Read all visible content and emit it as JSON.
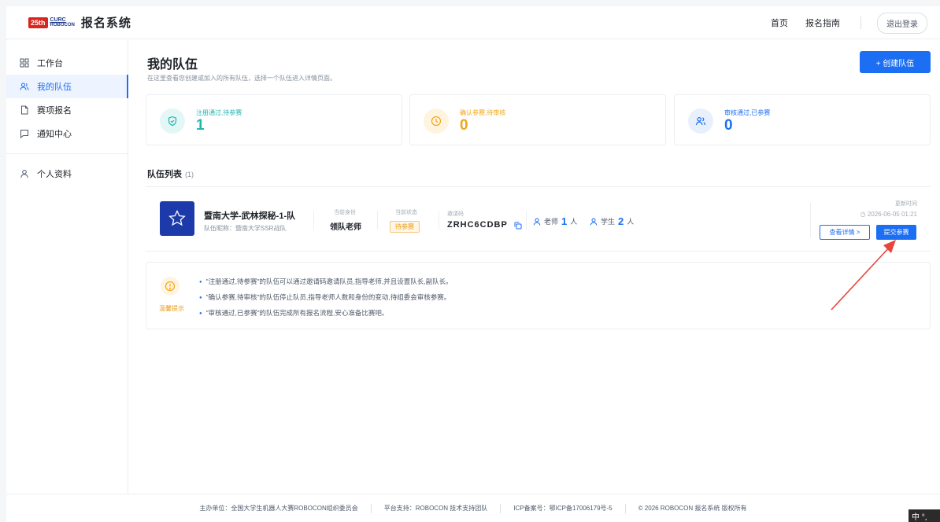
{
  "header": {
    "logo_badge": "25th",
    "logo_line1": "CURC",
    "logo_line2": "ROBOCON",
    "title": "报名系统",
    "nav": [
      "首页",
      "报名指南"
    ],
    "logout": "退出登录"
  },
  "sidebar": {
    "items": [
      {
        "label": "工作台",
        "icon": "grid-icon"
      },
      {
        "label": "我的队伍",
        "icon": "users-icon",
        "active": true
      },
      {
        "label": "赛项报名",
        "icon": "file-icon"
      },
      {
        "label": "通知中心",
        "icon": "message-icon"
      }
    ],
    "profile": {
      "label": "个人资料",
      "icon": "user-icon"
    }
  },
  "main": {
    "title": "我的队伍",
    "description": "在这里查看您创建或加入的所有队伍，选择一个队伍进入详情页面。",
    "create_button": "+ 创建队伍",
    "stats": [
      {
        "label": "注册通过,待参赛",
        "value": "1",
        "color": "#1fb6b1",
        "icon": "shield-check-icon"
      },
      {
        "label": "确认参赛,待审核",
        "value": "0",
        "color": "#f2a516",
        "icon": "clock-icon"
      },
      {
        "label": "审核通过,已参赛",
        "value": "0",
        "color": "#1c6ef2",
        "icon": "users-icon"
      }
    ],
    "list": {
      "title": "队伍列表",
      "count": "(1)"
    },
    "team": {
      "name": "暨南大学-武林探秘-1-队",
      "nickname": "队伍昵称：暨南大学SSR战队",
      "role_label": "当前身份",
      "role_value": "领队老师",
      "status_label": "当前状态",
      "status_value": "待参赛",
      "invite_label": "邀请码",
      "invite_code": "ZRHC6CDBP",
      "teacher_label": "老师",
      "teacher_count": "1",
      "teacher_unit": "人",
      "student_label": "学生",
      "student_count": "2",
      "student_unit": "人",
      "update_label": "更新时间",
      "update_time": "2026-06-05 01:21",
      "detail_button": "查看详情 >",
      "submit_button": "提交参赛"
    },
    "tips": {
      "label": "温馨提示",
      "lines": [
        "\"注册通过,待参赛\"的队伍可以通过邀请码邀请队员,指导老师,并且设置队长,副队长。",
        "\"确认参赛,待审核\"的队伍停止队员,指导老师人数和身份的变动,待组委会审核参赛。",
        "\"审核通过,已参赛\"的队伍完成所有报名流程,安心准备比赛吧。"
      ]
    }
  },
  "footer": {
    "items": [
      "主办单位：全国大学生机器人大赛ROBOCON组织委员会",
      "平台支持：ROBOCON 技术支持团队",
      "ICP备案号：鄂ICP备17006179号-5",
      "© 2026 ROBOCON 报名系统 版权所有"
    ]
  },
  "ime": {
    "text": "中 °,"
  },
  "colors": {
    "primary": "#1c6ef2",
    "teal": "#1fb6b1",
    "orange": "#f2a516",
    "arrow": "#e8453c"
  }
}
